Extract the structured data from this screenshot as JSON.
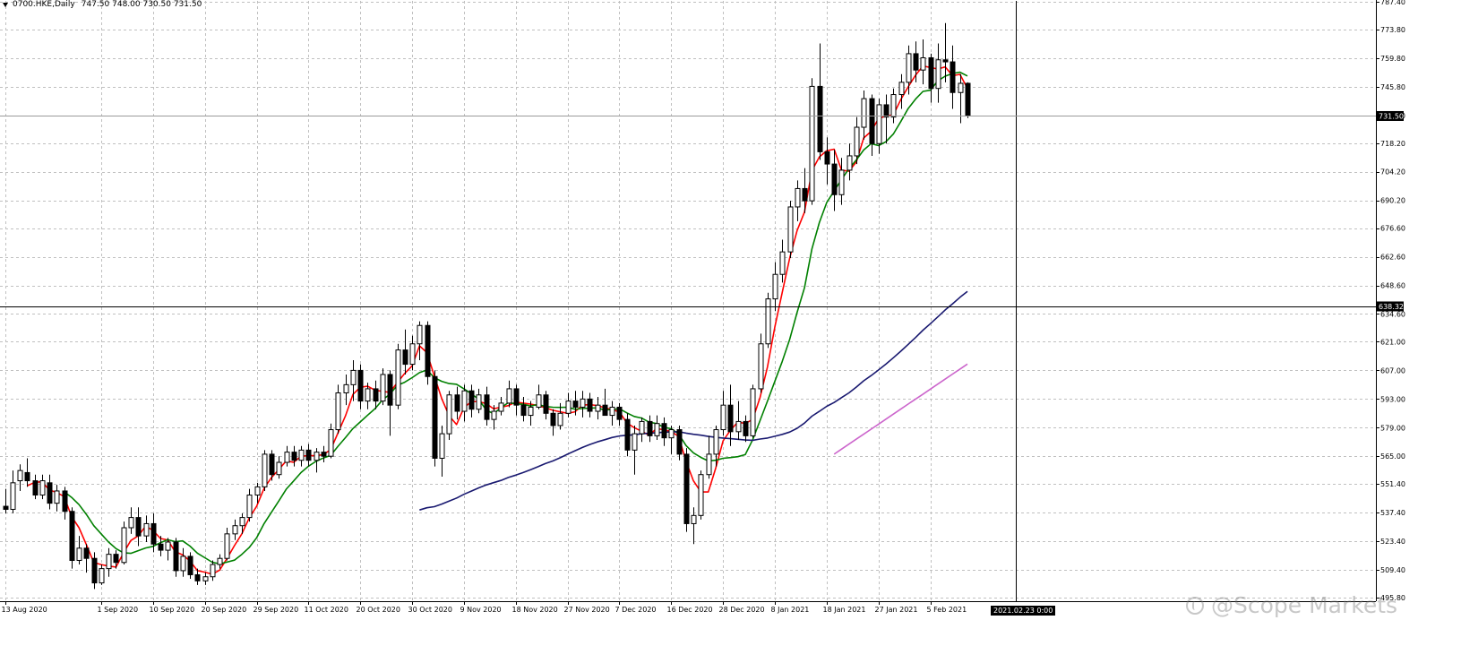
{
  "header": {
    "symbol": "0700.HKE,Daily",
    "ohlc": "747.50 748.00 730.50 731.50"
  },
  "watermark": "@Scope Markets",
  "date_marker": "2021.02.23 0:00",
  "colors": {
    "background": "#ffffff",
    "grid": "#c0c0c0",
    "candle_up": "#ffffff",
    "candle_down": "#000000",
    "ma_fast": "#ff0000",
    "ma_medium": "#008000",
    "ma_slow": "#191970",
    "ma_slowest": "#cc66cc",
    "crosshair": "#000000"
  },
  "chart_data": {
    "type": "candlestick",
    "ylim": [
      495.8,
      787.4
    ],
    "y_ticks": [
      "495.80",
      "509.40",
      "523.40",
      "537.40",
      "551.40",
      "565.00",
      "579.00",
      "593.00",
      "607.00",
      "621.00",
      "634.60",
      "648.60",
      "662.60",
      "676.60",
      "690.20",
      "704.20",
      "718.20",
      "731.80",
      "745.80",
      "759.80",
      "773.80",
      "787.40"
    ],
    "x_ticks": [
      {
        "label": "13 Aug 2020",
        "bar": 0
      },
      {
        "label": "1 Sep 2020",
        "bar": 13
      },
      {
        "label": "10 Sep 2020",
        "bar": 20
      },
      {
        "label": "20 Sep 2020",
        "bar": 27
      },
      {
        "label": "29 Sep 2020",
        "bar": 34
      },
      {
        "label": "11 Oct 2020",
        "bar": 41
      },
      {
        "label": "20 Oct 2020",
        "bar": 48
      },
      {
        "label": "30 Oct 2020",
        "bar": 55
      },
      {
        "label": "9 Nov 2020",
        "bar": 62
      },
      {
        "label": "18 Nov 2020",
        "bar": 69
      },
      {
        "label": "27 Nov 2020",
        "bar": 76
      },
      {
        "label": "7 Dec 2020",
        "bar": 83
      },
      {
        "label": "16 Dec 2020",
        "bar": 90
      },
      {
        "label": "28 Dec 2020",
        "bar": 97
      },
      {
        "label": "8 Jan 2021",
        "bar": 104
      },
      {
        "label": "18 Jan 2021",
        "bar": 111
      },
      {
        "label": "27 Jan 2021",
        "bar": 118
      },
      {
        "label": "5 Feb 2021",
        "bar": 125
      }
    ],
    "current_price_label": "731.50",
    "crosshair_price_label": "638.32",
    "crosshair_price": 638.32,
    "crosshair_bar": 136.6,
    "ohlc": [
      [
        540.5,
        549.0,
        537.0,
        539.0
      ],
      [
        539.0,
        558.0,
        537.0,
        552.0
      ],
      [
        553.0,
        561.0,
        548.0,
        558.0
      ],
      [
        557.0,
        564.0,
        550.0,
        553.0
      ],
      [
        553.0,
        556.0,
        544.0,
        546.0
      ],
      [
        546.0,
        556.0,
        544.0,
        553.0
      ],
      [
        552.0,
        556.0,
        539.0,
        542.0
      ],
      [
        542.0,
        551.0,
        538.0,
        548.0
      ],
      [
        548.0,
        550.0,
        534.0,
        538.0
      ],
      [
        538.0,
        540.0,
        510.0,
        514.0
      ],
      [
        514.0,
        526.0,
        512.0,
        520.0
      ],
      [
        520.0,
        522.0,
        508.0,
        515.0
      ],
      [
        515.0,
        518.0,
        500.0,
        503.0
      ],
      [
        503.0,
        512.0,
        502.0,
        510.0
      ],
      [
        510.0,
        520.0,
        506.0,
        517.0
      ],
      [
        517.0,
        519.0,
        510.0,
        513.0
      ],
      [
        513.0,
        533.0,
        512.0,
        530.0
      ],
      [
        530.0,
        540.0,
        527.0,
        535.0
      ],
      [
        535.0,
        540.0,
        521.0,
        526.0
      ],
      [
        526.0,
        536.0,
        523.0,
        532.0
      ],
      [
        532.0,
        537.0,
        518.0,
        522.0
      ],
      [
        522.0,
        526.0,
        516.0,
        519.0
      ],
      [
        519.0,
        525.0,
        514.0,
        523.0
      ],
      [
        523.0,
        525.0,
        506.0,
        509.0
      ],
      [
        509.0,
        520.0,
        506.0,
        516.0
      ],
      [
        516.0,
        518.0,
        505.0,
        507.0
      ],
      [
        507.0,
        510.0,
        502.0,
        504.0
      ],
      [
        504.0,
        508.0,
        502.0,
        506.0
      ],
      [
        506.0,
        514.0,
        504.0,
        512.0
      ],
      [
        512.0,
        517.0,
        510.0,
        515.0
      ],
      [
        515.0,
        530.0,
        514.0,
        527.0
      ],
      [
        527.0,
        534.0,
        524.0,
        531.0
      ],
      [
        531.0,
        537.0,
        527.0,
        535.0
      ],
      [
        535.0,
        549.0,
        533.0,
        546.0
      ],
      [
        546.0,
        552.0,
        542.0,
        550.0
      ],
      [
        550.0,
        568.0,
        548.0,
        566.0
      ],
      [
        566.0,
        568.0,
        553.0,
        556.0
      ],
      [
        556.0,
        565.0,
        554.0,
        562.0
      ],
      [
        562.0,
        570.0,
        560.0,
        567.0
      ],
      [
        567.0,
        570.0,
        560.0,
        563.0
      ],
      [
        563.0,
        570.0,
        560.0,
        568.0
      ],
      [
        568.0,
        571.0,
        560.0,
        563.0
      ],
      [
        563.0,
        569.0,
        557.0,
        567.0
      ],
      [
        567.0,
        570.0,
        562.0,
        565.0
      ],
      [
        565.0,
        581.0,
        564.0,
        578.0
      ],
      [
        578.0,
        600.0,
        576.0,
        596.0
      ],
      [
        596.0,
        605.0,
        590.0,
        600.0
      ],
      [
        600.0,
        612.0,
        592.0,
        607.0
      ],
      [
        607.0,
        610.0,
        588.0,
        592.0
      ],
      [
        592.0,
        601.0,
        588.0,
        598.0
      ],
      [
        598.0,
        602.0,
        588.0,
        592.0
      ],
      [
        592.0,
        608.0,
        590.0,
        605.0
      ],
      [
        605.0,
        607.0,
        575.0,
        590.0
      ],
      [
        590.0,
        620.0,
        588.0,
        617.0
      ],
      [
        617.0,
        627.0,
        605.0,
        610.0
      ],
      [
        610.0,
        624.0,
        607.0,
        620.0
      ],
      [
        620.0,
        631.0,
        612.0,
        629.0
      ],
      [
        629.0,
        631.0,
        600.0,
        604.0
      ],
      [
        604.0,
        607.0,
        560.0,
        564.0
      ],
      [
        564.0,
        580.0,
        555.0,
        576.0
      ],
      [
        576.0,
        597.0,
        573.0,
        595.0
      ],
      [
        595.0,
        599.0,
        583.0,
        587.0
      ],
      [
        587.0,
        600.0,
        582.0,
        597.0
      ],
      [
        597.0,
        600.0,
        584.0,
        588.0
      ],
      [
        588.0,
        598.0,
        586.0,
        595.0
      ],
      [
        595.0,
        599.0,
        580.0,
        583.0
      ],
      [
        583.0,
        590.0,
        578.0,
        587.0
      ],
      [
        587.0,
        594.0,
        585.0,
        591.0
      ],
      [
        591.0,
        602.0,
        589.0,
        598.0
      ],
      [
        598.0,
        600.0,
        585.0,
        590.0
      ],
      [
        590.0,
        594.0,
        582.0,
        585.0
      ],
      [
        585.0,
        592.0,
        580.0,
        589.0
      ],
      [
        589.0,
        600.0,
        588.0,
        595.0
      ],
      [
        595.0,
        597.0,
        583.0,
        586.0
      ],
      [
        586.0,
        588.0,
        575.0,
        580.0
      ],
      [
        580.0,
        591.0,
        578.0,
        586.0
      ],
      [
        586.0,
        596.0,
        584.0,
        592.0
      ],
      [
        592.0,
        597.0,
        585.0,
        589.0
      ],
      [
        589.0,
        597.0,
        584.0,
        593.0
      ],
      [
        593.0,
        596.0,
        584.0,
        587.0
      ],
      [
        587.0,
        594.0,
        583.0,
        590.0
      ],
      [
        590.0,
        598.0,
        586.0,
        585.0
      ],
      [
        585.0,
        592.0,
        580.0,
        589.0
      ],
      [
        589.0,
        591.0,
        580.0,
        583.0
      ],
      [
        583.0,
        586.0,
        565.0,
        568.0
      ],
      [
        568.0,
        580.0,
        556.0,
        576.0
      ],
      [
        576.0,
        584.0,
        572.0,
        582.0
      ],
      [
        582.0,
        585.0,
        572.0,
        575.0
      ],
      [
        575.0,
        585.0,
        573.0,
        581.0
      ],
      [
        581.0,
        584.0,
        570.0,
        574.0
      ],
      [
        574.0,
        580.0,
        566.0,
        578.0
      ],
      [
        578.0,
        580.0,
        563.0,
        566.0
      ],
      [
        566.0,
        569.0,
        528.0,
        532.0
      ],
      [
        532.0,
        540.0,
        522.0,
        536.0
      ],
      [
        536.0,
        558.0,
        534.0,
        556.0
      ],
      [
        556.0,
        575.0,
        554.0,
        566.0
      ],
      [
        566.0,
        580.0,
        560.0,
        578.0
      ],
      [
        578.0,
        597.0,
        575.0,
        590.0
      ],
      [
        590.0,
        600.0,
        570.0,
        577.0
      ],
      [
        577.0,
        592.0,
        573.0,
        582.0
      ],
      [
        582.0,
        585.0,
        572.0,
        575.0
      ],
      [
        575.0,
        600.0,
        574.0,
        598.0
      ],
      [
        598.0,
        625.0,
        596.0,
        620.0
      ],
      [
        620.0,
        645.0,
        618.0,
        642.0
      ],
      [
        642.0,
        660.0,
        636.0,
        654.0
      ],
      [
        654.0,
        671.0,
        650.0,
        665.0
      ],
      [
        665.0,
        690.0,
        662.0,
        687.0
      ],
      [
        687.0,
        700.0,
        680.0,
        696.0
      ],
      [
        696.0,
        706.0,
        684.0,
        690.0
      ],
      [
        690.0,
        750.0,
        688.0,
        746.0
      ],
      [
        746.0,
        767.0,
        710.0,
        714.0
      ],
      [
        714.0,
        721.0,
        698.0,
        708.0
      ],
      [
        708.0,
        715.0,
        685.0,
        693.0
      ],
      [
        693.0,
        711.0,
        688.0,
        705.0
      ],
      [
        705.0,
        718.0,
        700.0,
        712.0
      ],
      [
        712.0,
        731.0,
        708.0,
        726.0
      ],
      [
        726.0,
        744.0,
        720.0,
        740.0
      ],
      [
        740.0,
        742.0,
        712.0,
        718.0
      ],
      [
        718.0,
        740.0,
        713.0,
        737.0
      ],
      [
        737.0,
        742.0,
        718.0,
        731.0
      ],
      [
        731.0,
        745.0,
        728.0,
        742.0
      ],
      [
        742.0,
        752.0,
        735.0,
        748.0
      ],
      [
        748.0,
        766.0,
        742.0,
        762.0
      ],
      [
        762.0,
        768.0,
        748.0,
        754.0
      ],
      [
        754.0,
        769.0,
        747.0,
        760.0
      ],
      [
        760.0,
        762.0,
        738.0,
        745.0
      ],
      [
        745.0,
        767.0,
        738.0,
        759.0
      ],
      [
        759.0,
        777.0,
        748.0,
        758.0
      ],
      [
        758.0,
        766.0,
        735.0,
        743.0
      ],
      [
        743.0,
        752.0,
        728.0,
        747.5
      ],
      [
        747.5,
        748.0,
        730.5,
        731.5
      ]
    ],
    "series": [
      {
        "key": "ma_fast",
        "start": 3
      },
      {
        "key": "ma_medium",
        "start": 8
      },
      {
        "key": "ma_slow",
        "start": 56
      },
      {
        "key": "ma_slowest",
        "start": 112
      }
    ]
  }
}
